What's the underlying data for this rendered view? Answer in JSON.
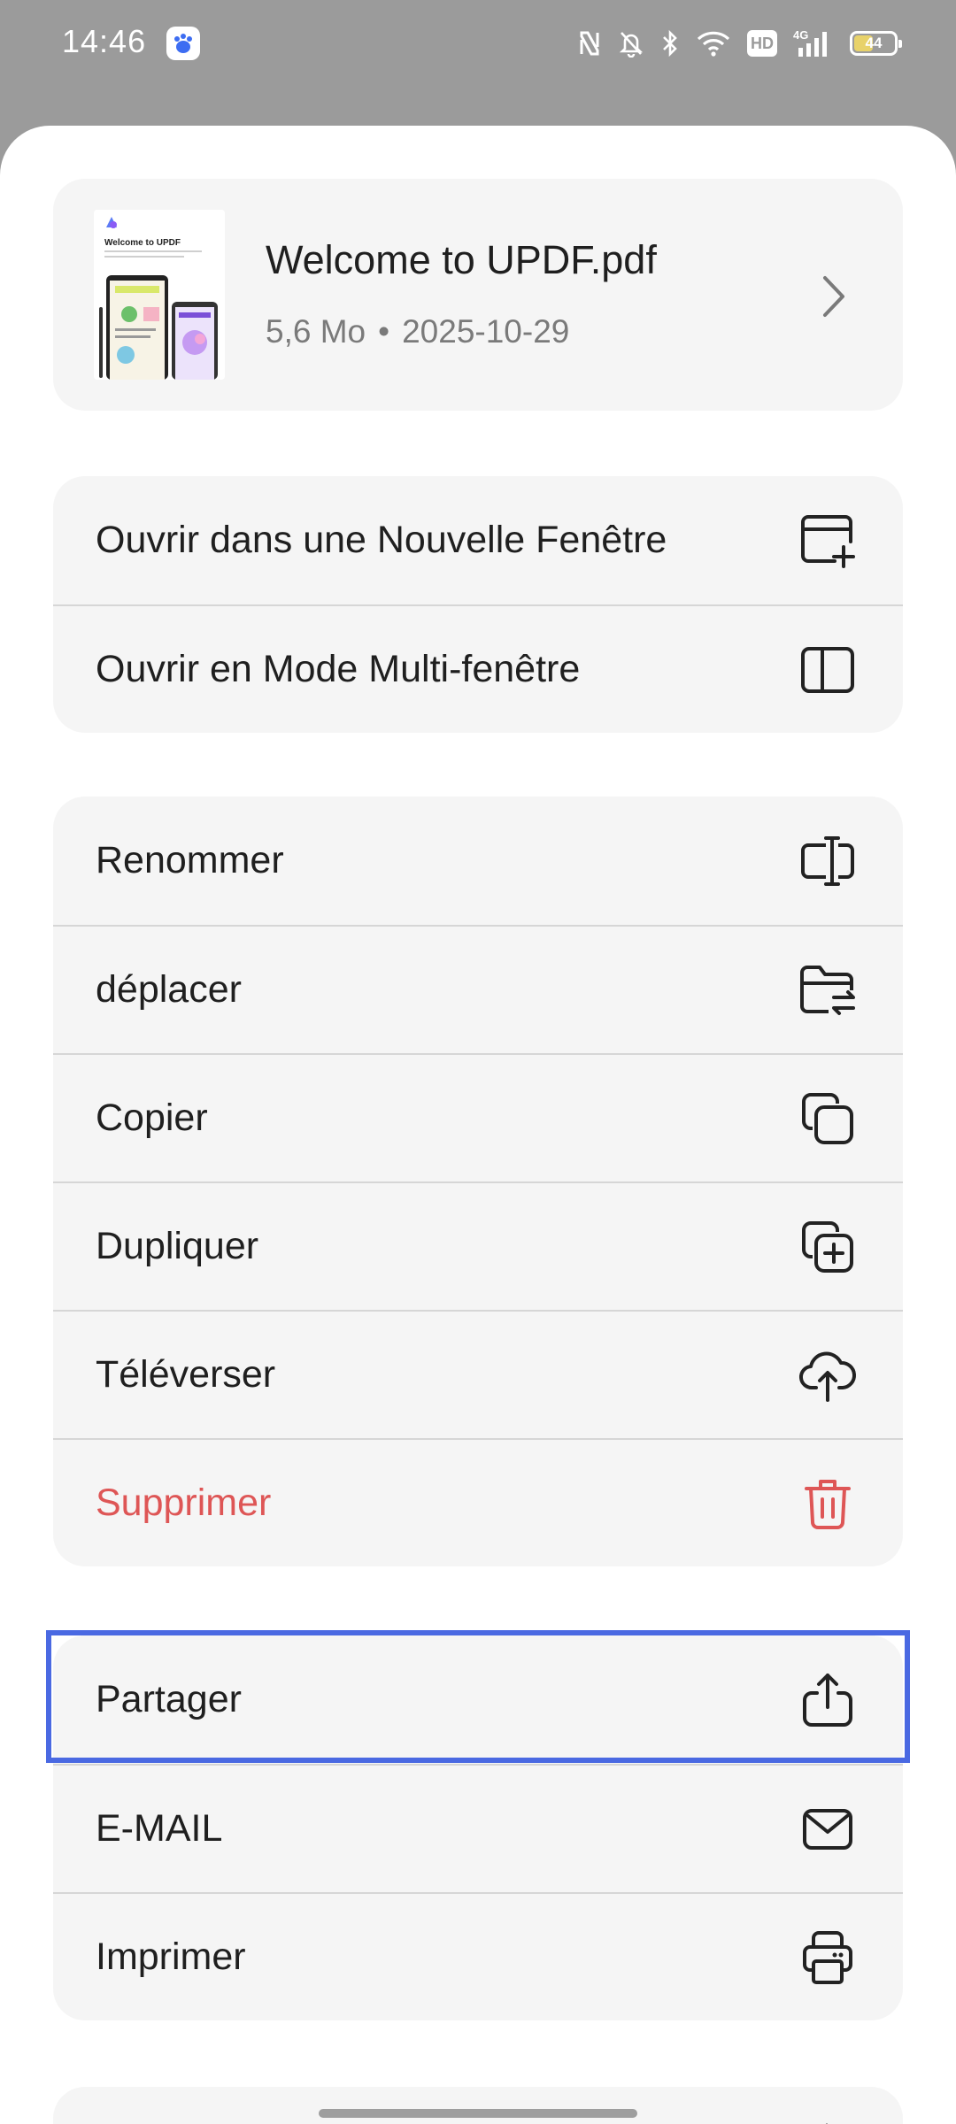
{
  "status_bar": {
    "time": "14:46",
    "network": "4G",
    "hd": "HD",
    "battery_level": "44",
    "battery_fraction": 0.44
  },
  "file": {
    "name": "Welcome to UPDF.pdf",
    "size": "5,6 Mo",
    "date": "2025-10-29",
    "thumbnail_title": "Welcome to UPDF"
  },
  "menu": {
    "open_section": [
      {
        "label": "Ouvrir dans une Nouvelle Fenêtre",
        "icon": "new-window-icon"
      },
      {
        "label": "Ouvrir en Mode Multi-fenêtre",
        "icon": "split-window-icon"
      }
    ],
    "edit_section": [
      {
        "label": "Renommer",
        "icon": "rename-icon"
      },
      {
        "label": "déplacer",
        "icon": "move-folder-icon"
      },
      {
        "label": "Copier",
        "icon": "copy-icon"
      },
      {
        "label": "Dupliquer",
        "icon": "duplicate-icon"
      },
      {
        "label": "Téléverser",
        "icon": "cloud-upload-icon"
      },
      {
        "label": "Supprimer",
        "icon": "trash-icon"
      }
    ],
    "share_section": [
      {
        "label": "Partager",
        "icon": "share-icon"
      },
      {
        "label": "E-MAIL",
        "icon": "mail-icon"
      },
      {
        "label": "Imprimer",
        "icon": "printer-icon"
      }
    ]
  },
  "colors": {
    "danger": "#de5656",
    "highlight": "#4a69e2",
    "card_bg": "#f5f5f5",
    "scrim": "#9b9b9b"
  }
}
